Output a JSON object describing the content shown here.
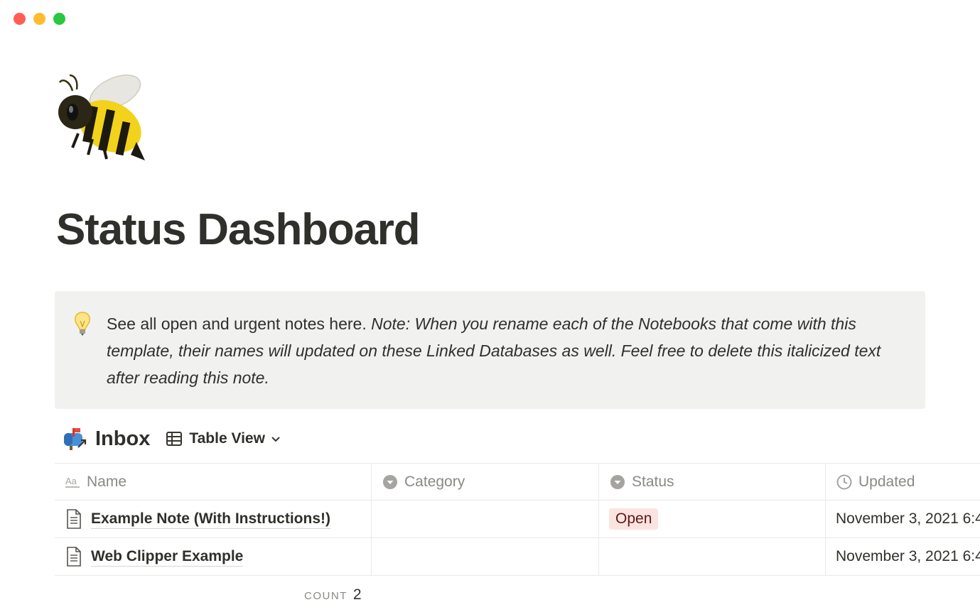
{
  "window": {
    "controls": [
      "close",
      "minimize",
      "zoom"
    ]
  },
  "page": {
    "icon": "bee-icon",
    "title": "Status Dashboard"
  },
  "callout": {
    "icon": "lightbulb-icon",
    "text_plain": "See all open and urgent notes here. ",
    "text_italic": "Note: When you rename each of the Notebooks that come with this template, their names will updated on these Linked Databases as well. Feel free to delete this italicized text after reading this note."
  },
  "database": {
    "icon": "mailbox-icon",
    "title": "Inbox",
    "view_icon": "table-icon",
    "view_label": "Table View",
    "columns": [
      {
        "label": "Name",
        "icon": "text-property-icon"
      },
      {
        "label": "Category",
        "icon": "select-property-icon"
      },
      {
        "label": "Status",
        "icon": "select-property-icon"
      },
      {
        "label": "Updated",
        "icon": "clock-icon"
      }
    ],
    "rows": [
      {
        "name": "Example Note (With Instructions!)",
        "category": "",
        "status": "Open",
        "updated": "November 3, 2021 6:4"
      },
      {
        "name": "Web Clipper Example",
        "category": "",
        "status": "",
        "updated": "November 3, 2021 6:4"
      }
    ],
    "footer": {
      "count_label": "COUNT",
      "count_value": "2"
    }
  },
  "colors": {
    "status_open_bg": "#fbe4e0",
    "callout_bg": "#f1f1ef"
  }
}
